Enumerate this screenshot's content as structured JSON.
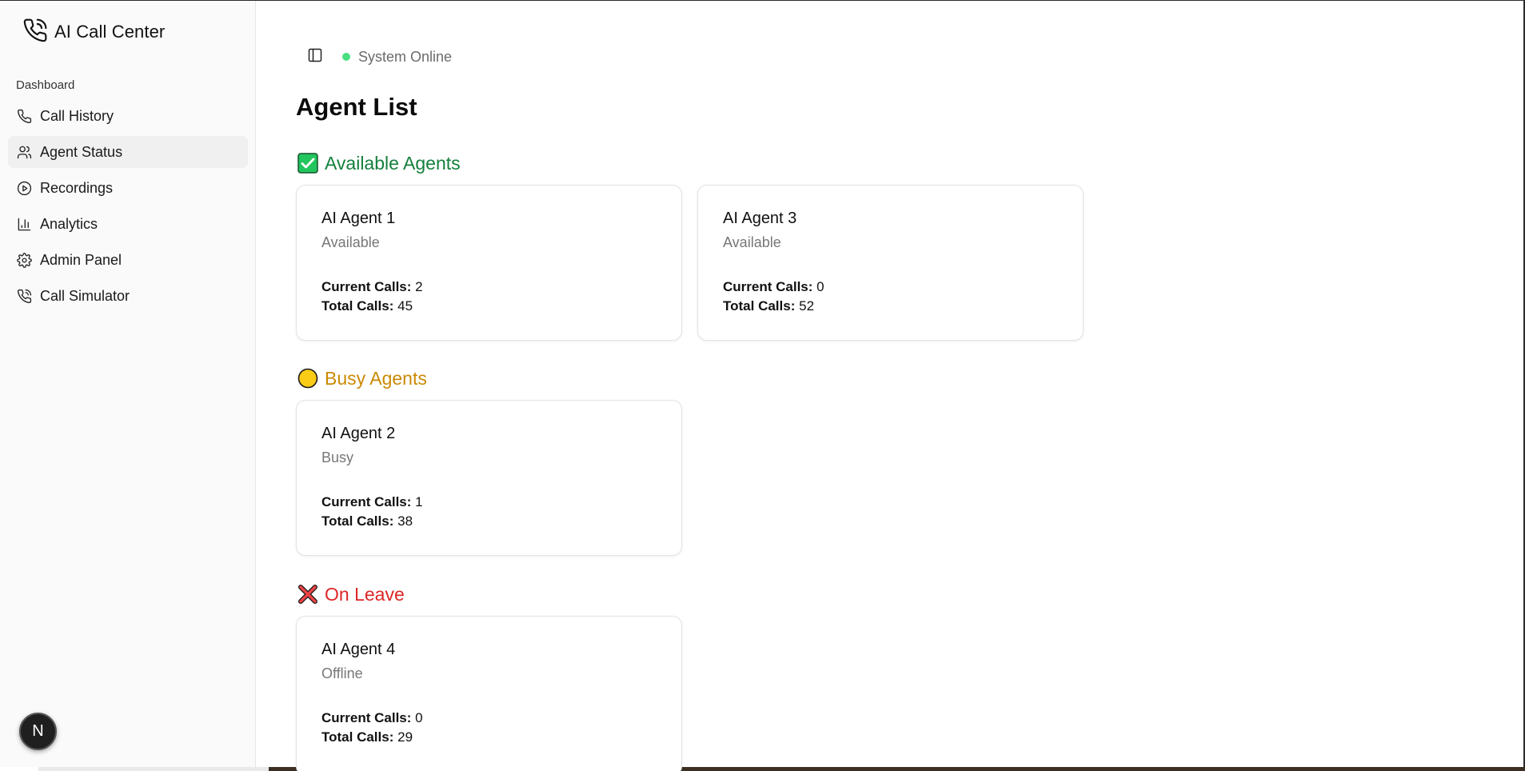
{
  "app": {
    "title": "AI Call Center"
  },
  "sidebar": {
    "group_label": "Dashboard",
    "items": [
      {
        "label": "Call History",
        "icon": "phone-icon"
      },
      {
        "label": "Agent Status",
        "icon": "users-icon",
        "active": true
      },
      {
        "label": "Recordings",
        "icon": "play-circle-icon"
      },
      {
        "label": "Analytics",
        "icon": "bar-chart-icon"
      },
      {
        "label": "Admin Panel",
        "icon": "gear-icon"
      },
      {
        "label": "Call Simulator",
        "icon": "phone-call-icon"
      }
    ]
  },
  "header": {
    "status_text": "System Online",
    "status_color": "#4ade80"
  },
  "page": {
    "title": "Agent List"
  },
  "sections": {
    "available": {
      "title": "Available Agents",
      "color": "#15803d"
    },
    "busy": {
      "title": "Busy Agents",
      "color": "#ca8a04"
    },
    "leave": {
      "title": "On Leave",
      "color": "#dc2626"
    }
  },
  "labels": {
    "current_calls": "Current Calls:",
    "total_calls": "Total Calls:"
  },
  "agents": [
    {
      "name": "AI Agent 1",
      "status": "Available",
      "current_calls": "2",
      "total_calls": "45"
    },
    {
      "name": "AI Agent 3",
      "status": "Available",
      "current_calls": "0",
      "total_calls": "52"
    },
    {
      "name": "AI Agent 2",
      "status": "Busy",
      "current_calls": "1",
      "total_calls": "38"
    },
    {
      "name": "AI Agent 4",
      "status": "Offline",
      "current_calls": "0",
      "total_calls": "29"
    }
  ],
  "badge": {
    "letter": "N"
  }
}
